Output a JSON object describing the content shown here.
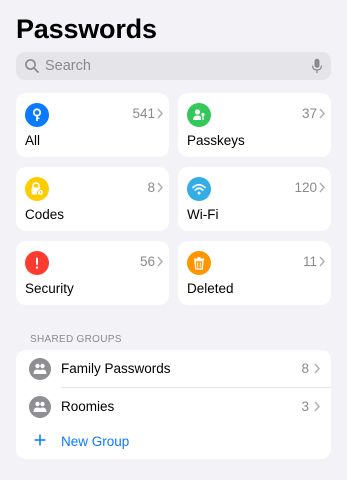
{
  "header": {
    "title": "Passwords"
  },
  "search": {
    "placeholder": "Search"
  },
  "categories": [
    {
      "key": "all",
      "label": "All",
      "count": "541",
      "icon": "key-icon",
      "color": "#0a7aff"
    },
    {
      "key": "passkeys",
      "label": "Passkeys",
      "count": "37",
      "icon": "passkey-person-icon",
      "color": "#34c759"
    },
    {
      "key": "codes",
      "label": "Codes",
      "count": "8",
      "icon": "lock-clock-icon",
      "color": "#ffcc00"
    },
    {
      "key": "wifi",
      "label": "Wi-Fi",
      "count": "120",
      "icon": "wifi-icon",
      "color": "#32ade6"
    },
    {
      "key": "security",
      "label": "Security",
      "count": "56",
      "icon": "exclamation-icon",
      "color": "#ff3b30"
    },
    {
      "key": "deleted",
      "label": "Deleted",
      "count": "11",
      "icon": "trash-icon",
      "color": "#ff9500"
    }
  ],
  "shared_groups": {
    "header": "SHARED GROUPS",
    "items": [
      {
        "name": "Family Passwords",
        "count": "8",
        "icon": "people-icon"
      },
      {
        "name": "Roomies",
        "count": "3",
        "icon": "people-icon"
      }
    ],
    "new_group_label": "New Group"
  },
  "colors": {
    "accent": "#0a7aff",
    "secondary_text": "#8a8a8e",
    "background": "#f2f2f7"
  }
}
